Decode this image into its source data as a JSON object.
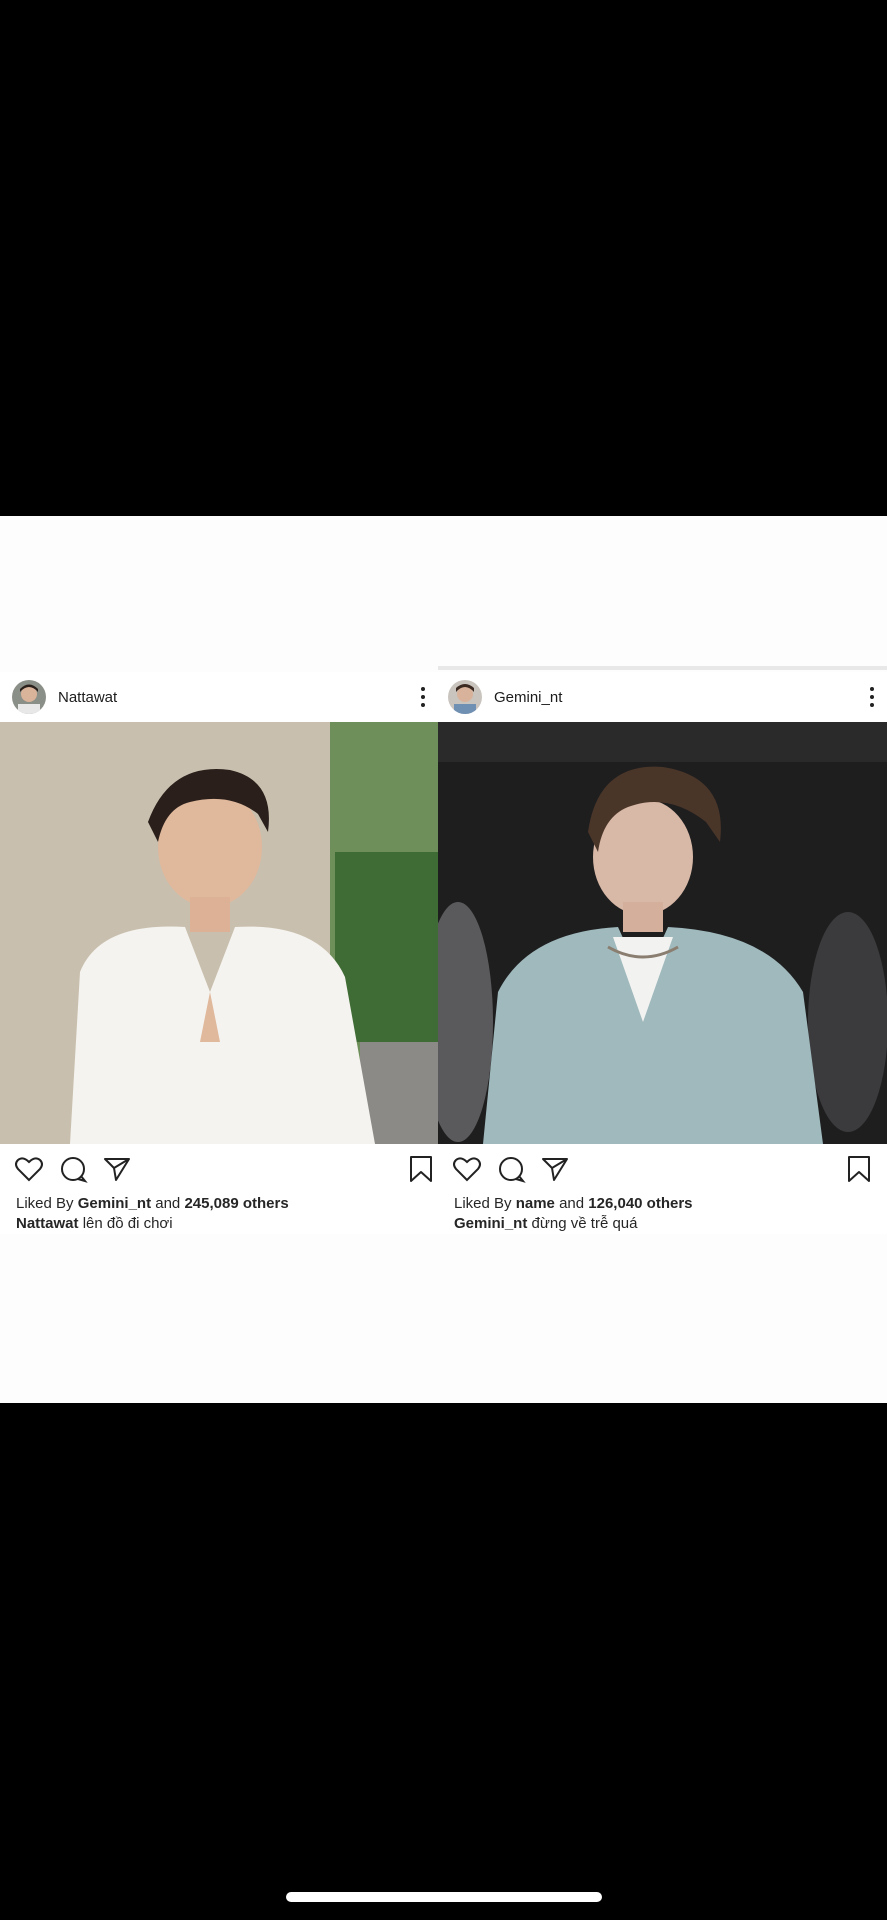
{
  "posts": [
    {
      "username": "Nattawat",
      "liked_by_prefix": "Liked By",
      "liked_by_user": "Gemini_nt",
      "liked_by_and": "and",
      "likes_count": "245,089 others",
      "caption_user": "Nattawat",
      "caption_text": "lên đồ đi chơi"
    },
    {
      "username": "Gemini_nt",
      "liked_by_prefix": "Liked By",
      "liked_by_user": "name",
      "liked_by_and": "and",
      "likes_count": "126,040 others",
      "caption_user": "Gemini_nt",
      "caption_text": "đừng về trễ quá"
    }
  ],
  "icons": {
    "like": "heart-icon",
    "comment": "comment-bubble-icon",
    "share": "paper-plane-icon",
    "save": "bookmark-icon",
    "more": "more-options-icon"
  },
  "colors": {
    "background": "#000000",
    "panel": "#fdfdfd",
    "text": "#262626"
  }
}
